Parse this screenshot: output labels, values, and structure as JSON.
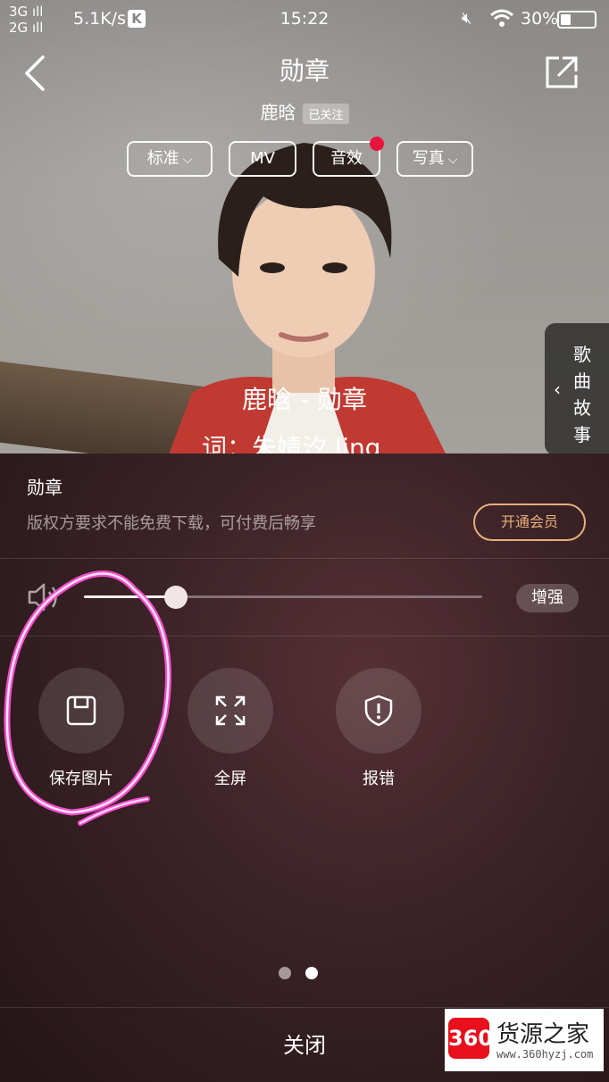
{
  "status_bar": {
    "signal_1": "3G",
    "signal_2": "2G",
    "net_speed": "5.1K/s",
    "k_badge": "K",
    "time": "15:22",
    "battery_percent": "30%",
    "battery_level": 0.3
  },
  "header": {
    "title": "勋章",
    "artist": "鹿晗",
    "follow_badge": "已关注"
  },
  "chips": {
    "standard": "标准",
    "mv": "MV",
    "sound_effect": "音效",
    "photo": "写真"
  },
  "lyrics": {
    "line1": "鹿晗 - 勋章",
    "line2": "词：朱婧汐 Jing"
  },
  "story_tab": {
    "label": "歌曲故事"
  },
  "sheet": {
    "song_title": "勋章",
    "copyright_note": "版权方要求不能免费下载，可付费后畅享",
    "vip_button": "开通会员",
    "volume_level": 0.23,
    "boost_button": "增强",
    "actions": {
      "save": "保存图片",
      "fullscreen": "全屏",
      "report": "报错"
    },
    "close": "关闭"
  },
  "watermark": {
    "badge": "360",
    "name": "货源之家",
    "url": "www.360hyzj.com"
  },
  "colors": {
    "accent_gold": "#e6b07a",
    "red_dot": "#e8143c",
    "annotation_pink": "#ff4fd8"
  }
}
